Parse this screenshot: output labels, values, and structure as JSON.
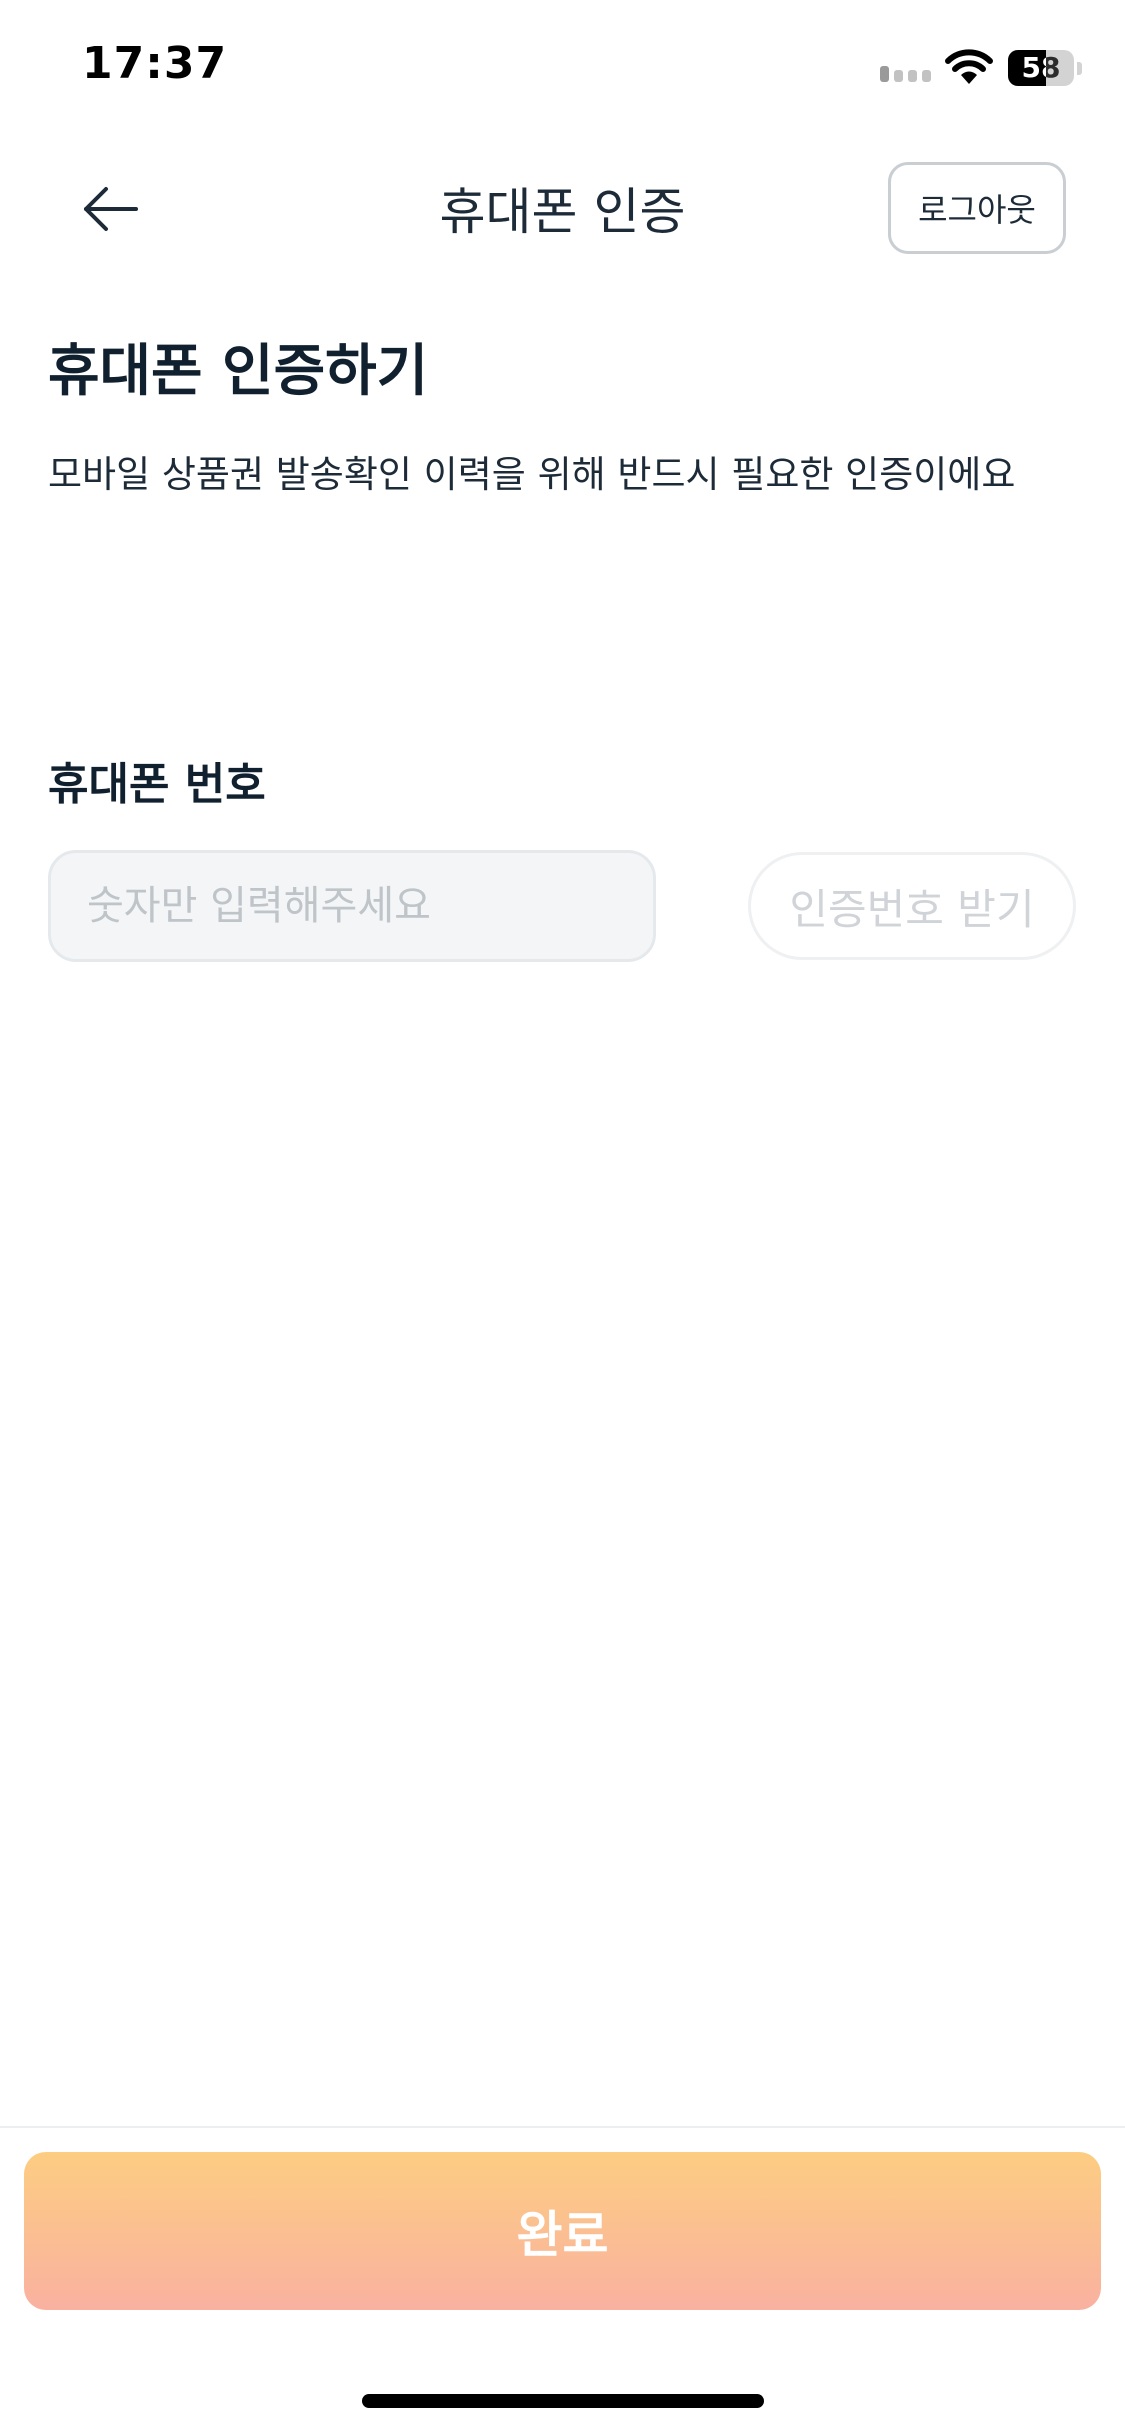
{
  "status_bar": {
    "time": "17:37",
    "battery_level": "58",
    "signal_icon": "cellular-signal-icon",
    "wifi_icon": "wifi-icon",
    "battery_icon": "battery-icon"
  },
  "nav": {
    "back_icon": "arrow-left-icon",
    "title": "휴대폰 인증",
    "logout_label": "로그아웃"
  },
  "content": {
    "heading": "휴대폰 인증하기",
    "description": "모바일 상품권 발송확인 이력을 위해 반드시 필요한 인증이에요",
    "phone_label": "휴대폰 번호",
    "phone_value": "",
    "phone_placeholder": "숫자만 입력해주세요",
    "verify_button_label": "인증번호 받기"
  },
  "footer": {
    "complete_label": "완료"
  },
  "colors": {
    "text_primary": "#10202e",
    "button_gradient_top": "#fdcd82",
    "button_gradient_bottom": "#f9b1a0",
    "input_background": "#f3f5f6",
    "disabled_text": "#d0d4d8"
  }
}
